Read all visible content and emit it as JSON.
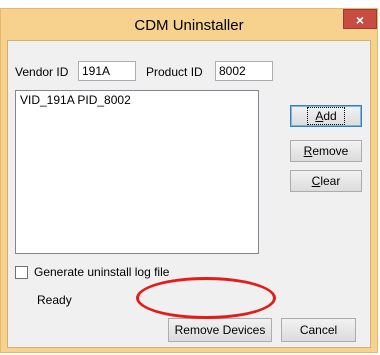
{
  "window": {
    "title": "CDM Uninstaller",
    "close_label": "×"
  },
  "fields": {
    "vendor_id_label": "Vendor ID",
    "vendor_id_value": "191A",
    "product_id_label": "Product ID",
    "product_id_value": "8002"
  },
  "device_list": {
    "items": [
      "VID_191A PID_8002"
    ]
  },
  "side_buttons": {
    "add": {
      "mnemonic": "A",
      "rest": "dd"
    },
    "remove": {
      "mnemonic": "R",
      "rest": "emove"
    },
    "clear": {
      "mnemonic": "C",
      "rest": "lear"
    }
  },
  "log_option": {
    "label": "Generate uninstall log file",
    "checked": false
  },
  "status": {
    "text": "Ready"
  },
  "bottom_buttons": {
    "remove_devices": "Remove Devices",
    "cancel": "Cancel"
  },
  "annotation": {
    "highlight_color": "#e41b17"
  }
}
